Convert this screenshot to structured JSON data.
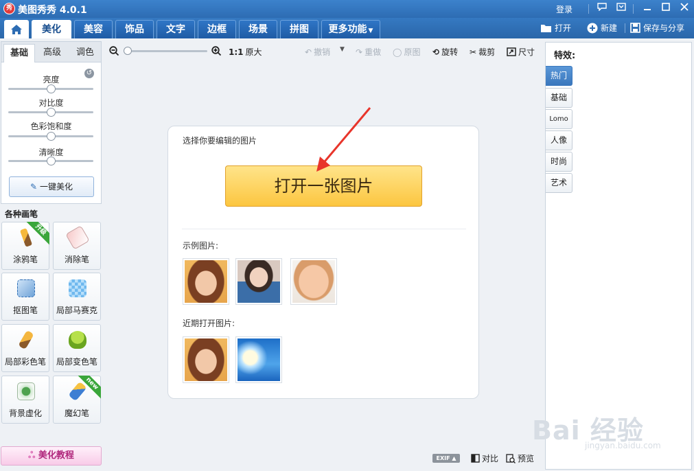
{
  "window": {
    "title": "美图秀秀 4.0.1",
    "logo_text": "秀",
    "login": "登录"
  },
  "tabs": [
    "美化",
    "美容",
    "饰品",
    "文字",
    "边框",
    "场景",
    "拼图",
    "更多功能"
  ],
  "active_tab": "美化",
  "top_actions": {
    "open": "打开",
    "new": "新建",
    "save_share": "保存与分享"
  },
  "left": {
    "subtabs": [
      "基础",
      "高级",
      "调色"
    ],
    "sliders": [
      {
        "label": "亮度",
        "value": 0.5
      },
      {
        "label": "对比度",
        "value": 0.5
      },
      {
        "label": "色彩饱和度",
        "value": 0.5
      },
      {
        "label": "清晰度",
        "value": 0.5
      }
    ],
    "one_key": "一键美化",
    "brushes_title": "各种画笔",
    "brushes": [
      {
        "label": "涂鸦笔",
        "badge": "升级"
      },
      {
        "label": "消除笔",
        "badge": ""
      },
      {
        "label": "抠图笔",
        "badge": ""
      },
      {
        "label": "局部马赛克",
        "badge": ""
      },
      {
        "label": "局部彩色笔",
        "badge": ""
      },
      {
        "label": "局部变色笔",
        "badge": ""
      },
      {
        "label": "背景虚化",
        "badge": ""
      },
      {
        "label": "魔幻笔",
        "badge": "new"
      }
    ],
    "tutorial": "美化教程"
  },
  "toolbar": {
    "zoom_ratio": "1:1",
    "original_size": "原大",
    "undo": "撤销",
    "redo": "重做",
    "original": "原图",
    "rotate": "旋转",
    "crop": "裁剪",
    "resize": "尺寸"
  },
  "card": {
    "prompt": "选择你要编辑的图片",
    "open_button": "打开一张图片",
    "examples_label": "示例图片:",
    "recent_label": "近期打开图片:"
  },
  "effects": {
    "title": "特效:",
    "tabs": [
      "热门",
      "基础",
      "Lomo",
      "人像",
      "时尚",
      "艺术"
    ],
    "active": "热门"
  },
  "bottom": {
    "exif": "EXIF",
    "compare": "对比",
    "preview": "预览"
  },
  "watermark": {
    "brand": "Bai 经验",
    "url": "jingyan.baidu.com"
  },
  "colors": {
    "title_blue": "#2d6cb3",
    "accent_yellow": "#fcc640",
    "arrow_red": "#e8352b"
  }
}
